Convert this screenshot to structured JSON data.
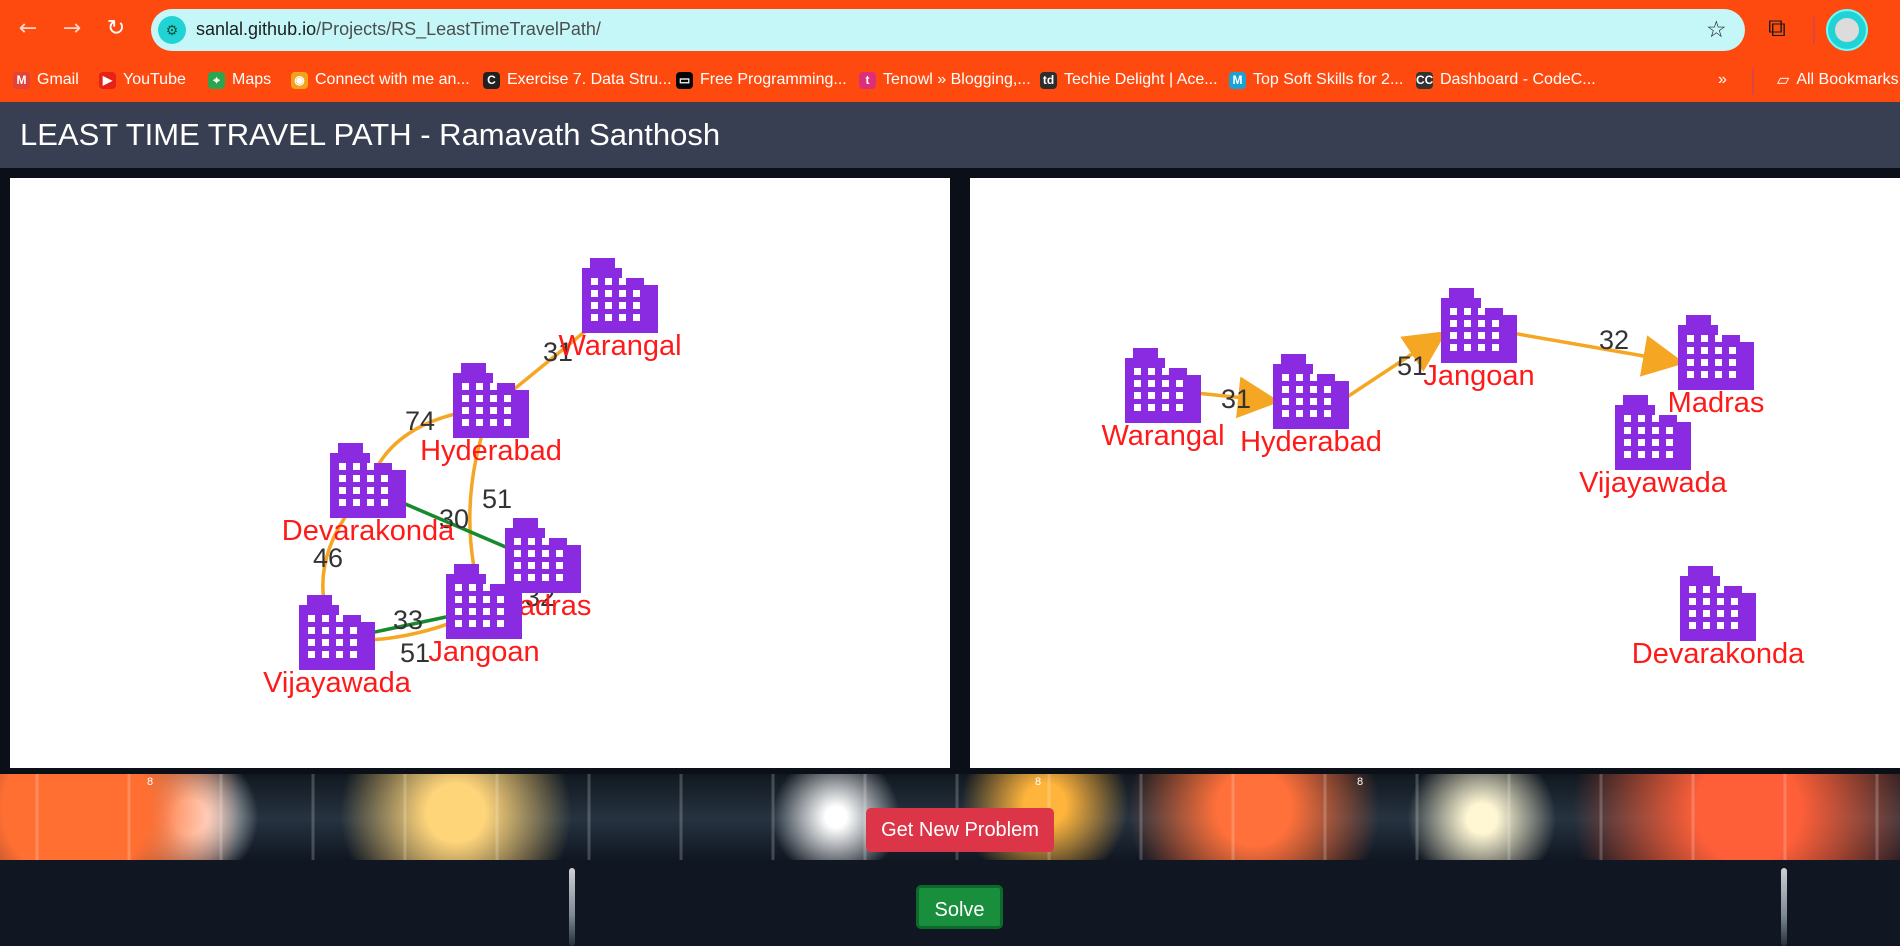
{
  "browser": {
    "address": {
      "host": "sanlal.github.io",
      "path": "/Projects/RS_LeastTimeTravelPath/"
    },
    "bookmarks": [
      {
        "label": "Gmail",
        "icon": "gmail-icon",
        "color": "#e04338",
        "glyph": "M"
      },
      {
        "label": "YouTube",
        "icon": "youtube-icon",
        "color": "#e62117",
        "glyph": "▶"
      },
      {
        "label": "Maps",
        "icon": "maps-icon",
        "color": "#2da44e",
        "glyph": "⌖"
      },
      {
        "label": "Connect with me an...",
        "icon": "link-icon",
        "color": "#f3a21b",
        "glyph": "◉"
      },
      {
        "label": "Exercise 7. Data Stru...",
        "icon": "c-icon",
        "color": "#212121",
        "glyph": "C"
      },
      {
        "label": "Free Programming...",
        "icon": "book-icon",
        "color": "#050505",
        "glyph": "▭"
      },
      {
        "label": "Tenowl » Blogging,...",
        "icon": "tenowl-icon",
        "color": "#df2e78",
        "glyph": "t"
      },
      {
        "label": "Techie Delight | Ace...",
        "icon": "td-icon",
        "color": "#2d2d2d",
        "glyph": "td"
      },
      {
        "label": "Top Soft Skills for 2...",
        "icon": "medium-icon",
        "color": "#1aa1d6",
        "glyph": "M"
      },
      {
        "label": "Dashboard - CodeC...",
        "icon": "codechef-icon",
        "color": "#333",
        "glyph": "CC"
      }
    ],
    "all_bookmarks_label": "All Bookmarks"
  },
  "app": {
    "title": "LEAST TIME TRAVEL PATH - Ramavath Santhosh"
  },
  "panels": [
    {
      "nodes": [
        {
          "label": "Warangal"
        },
        {
          "label": "Hyderabad"
        },
        {
          "label": "Devarakonda"
        },
        {
          "label": "Madras"
        },
        {
          "label": "Jangoan"
        },
        {
          "label": "Vijayawada"
        }
      ],
      "edges": [
        {
          "from": "Warangal",
          "to": "Hyderabad",
          "weight": "31",
          "color": "orange"
        },
        {
          "from": "Hyderabad",
          "to": "Devarakonda",
          "weight": "74",
          "color": "orange"
        },
        {
          "from": "Hyderabad",
          "to": "Jangoan",
          "weight": "51",
          "color": "orange"
        },
        {
          "from": "Devarakonda",
          "to": "Madras",
          "weight": "30",
          "color": "green"
        },
        {
          "from": "Devarakonda",
          "to": "Vijayawada",
          "weight": "46",
          "color": "orange"
        },
        {
          "from": "Vijayawada",
          "to": "Jangoan",
          "weight": "33",
          "color": "green"
        },
        {
          "from": "Vijayawada",
          "to": "Jangoan",
          "weight": "51",
          "color": "orange"
        },
        {
          "from": "Jangoan",
          "to": "Madras",
          "weight": "32",
          "color": "orange"
        }
      ]
    },
    {
      "nodes": [
        {
          "label": "Warangal"
        },
        {
          "label": "Hyderabad"
        },
        {
          "label": "Jangoan"
        },
        {
          "label": "Madras"
        },
        {
          "label": "Vijayawada"
        },
        {
          "label": "Devarakonda"
        }
      ],
      "edges": [
        {
          "from": "Warangal",
          "to": "Hyderabad",
          "weight": "31",
          "color": "orange"
        },
        {
          "from": "Hyderabad",
          "to": "Jangoan",
          "weight": "51",
          "color": "orange"
        },
        {
          "from": "Jangoan",
          "to": "Madras",
          "weight": "32",
          "color": "orange"
        }
      ]
    }
  ],
  "buttons": {
    "new_problem": "Get New Problem",
    "solve": "Solve"
  },
  "background_marks": [
    "8",
    "8",
    "8"
  ],
  "colors": {
    "browser": "#ff4a0f",
    "omnibox": "#c5f7f8",
    "header": "#393f52",
    "node": "#8a2be2",
    "node_label": "#ff1a1a",
    "edge_orange": "#f5a623",
    "edge_green": "#168a2d",
    "button_red": "#dc3548",
    "button_green": "#198f3d"
  }
}
